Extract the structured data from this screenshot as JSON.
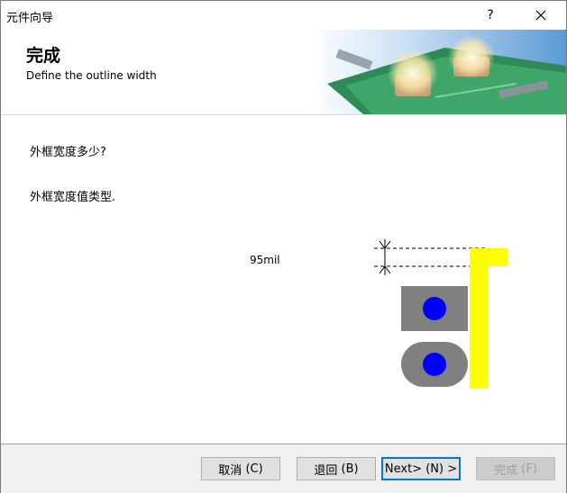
{
  "window": {
    "title": "元件向导",
    "help_label": "?"
  },
  "header": {
    "title": "完成",
    "subtitle": "Define the outline width"
  },
  "content": {
    "question": "外框宽度多少?",
    "prompt": "外框宽度值类型.",
    "width_value": "95mil"
  },
  "buttons": {
    "cancel": {
      "label": "取消",
      "key": "(C)"
    },
    "back": {
      "label": "退回",
      "key": "(B)"
    },
    "next": {
      "label": "Next>",
      "key": "(N)",
      "suffix": ">"
    },
    "finish": {
      "label": "完成",
      "key": "(F)"
    }
  },
  "colors": {
    "outline": "#ffff00",
    "pad": "#808080",
    "hole": "#0000ff",
    "accent": "#0078d7"
  }
}
